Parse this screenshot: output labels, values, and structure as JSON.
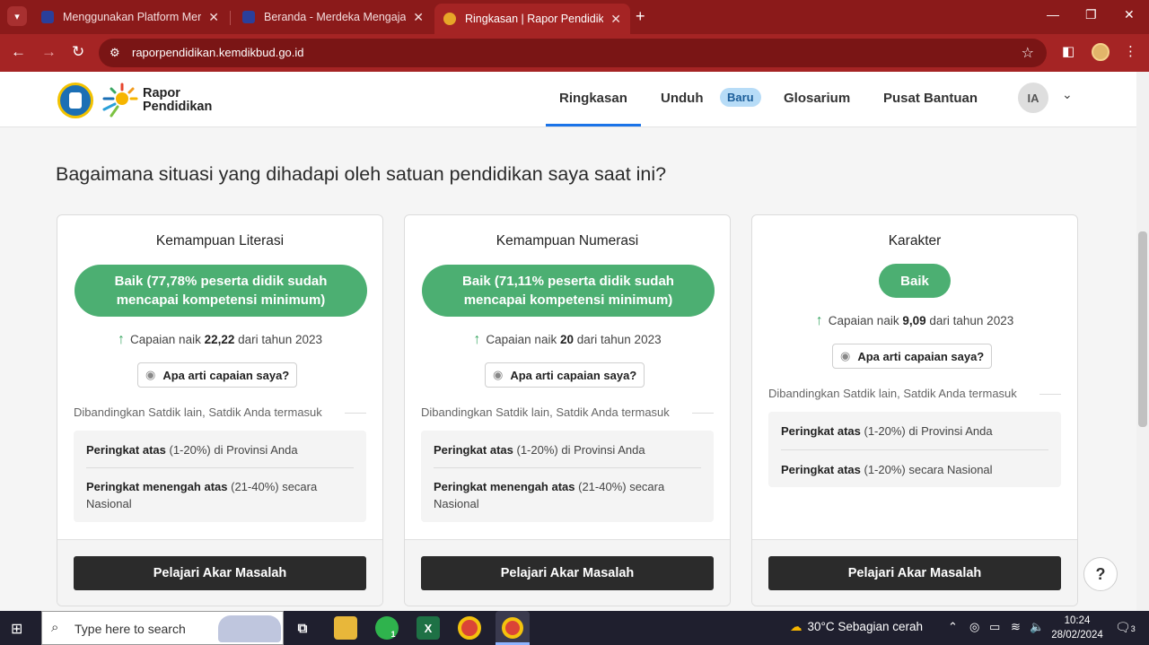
{
  "browser": {
    "tabs": [
      {
        "title": "Menggunakan Platform Merdeka Mengajar",
        "active": false
      },
      {
        "title": "Beranda - Merdeka Mengajar",
        "active": false
      },
      {
        "title": "Ringkasan | Rapor Pendidikan",
        "active": true
      }
    ],
    "url": "raporpendidikan.kemdikbud.go.id"
  },
  "site": {
    "brand_line1": "Rapor",
    "brand_line2": "Pendidikan",
    "nav": [
      {
        "label": "Ringkasan",
        "active": true
      },
      {
        "label": "Unduh",
        "active": false
      },
      {
        "label": "Glosarium",
        "active": false
      },
      {
        "label": "Pusat Bantuan",
        "active": false
      }
    ],
    "badge_new": "Baru",
    "avatar_initials": "IA"
  },
  "main": {
    "question": "Bagaimana situasi yang dihadapi oleh satuan pendidikan saya saat ini?",
    "cards": [
      {
        "title": "Kemampuan Literasi",
        "status": "Baik (77,78% peserta didik sudah mencapai kompetensi minimum)",
        "trend_prefix": "Capaian naik",
        "trend_value": "22,22",
        "trend_suffix": "dari tahun 2023",
        "meaning_button": "Apa arti capaian saya?",
        "compare_label": "Dibandingkan Satdik lain, Satdik Anda termasuk",
        "ranks": [
          {
            "bold": "Peringkat atas",
            "rest": " (1-20%) di Provinsi Anda"
          },
          {
            "bold": "Peringkat menengah atas",
            "rest": " (21-40%) secara Nasional"
          }
        ],
        "cta": "Pelajari Akar Masalah"
      },
      {
        "title": "Kemampuan Numerasi",
        "status": "Baik (71,11% peserta didik sudah mencapai kompetensi minimum)",
        "trend_prefix": "Capaian naik",
        "trend_value": "20",
        "trend_suffix": "dari tahun 2023",
        "meaning_button": "Apa arti capaian saya?",
        "compare_label": "Dibandingkan Satdik lain, Satdik Anda termasuk",
        "ranks": [
          {
            "bold": "Peringkat atas",
            "rest": " (1-20%) di Provinsi Anda"
          },
          {
            "bold": "Peringkat menengah atas",
            "rest": " (21-40%) secara Nasional"
          }
        ],
        "cta": "Pelajari Akar Masalah"
      },
      {
        "title": "Karakter",
        "status": "Baik",
        "trend_prefix": "Capaian naik",
        "trend_value": "9,09",
        "trend_suffix": "dari tahun 2023",
        "meaning_button": "Apa arti capaian saya?",
        "compare_label": "Dibandingkan Satdik lain, Satdik Anda termasuk",
        "ranks": [
          {
            "bold": "Peringkat atas",
            "rest": " (1-20%) di Provinsi Anda"
          },
          {
            "bold": "Peringkat atas",
            "rest": " (1-20%) secara Nasional"
          }
        ],
        "cta": "Pelajari Akar Masalah"
      }
    ]
  },
  "taskbar": {
    "search_placeholder": "Type here to search",
    "whatsapp_badge": "1",
    "weather": "30°C  Sebagian cerah",
    "time": "10:24",
    "date": "28/02/2024",
    "notification_count": "3"
  },
  "colors": {
    "chrome_frame": "#8b1a1a",
    "chrome_toolbar": "#a52424",
    "status_green": "#4caf72",
    "cta_dark": "#2b2b2b",
    "nav_active_underline": "#1a73e8"
  }
}
